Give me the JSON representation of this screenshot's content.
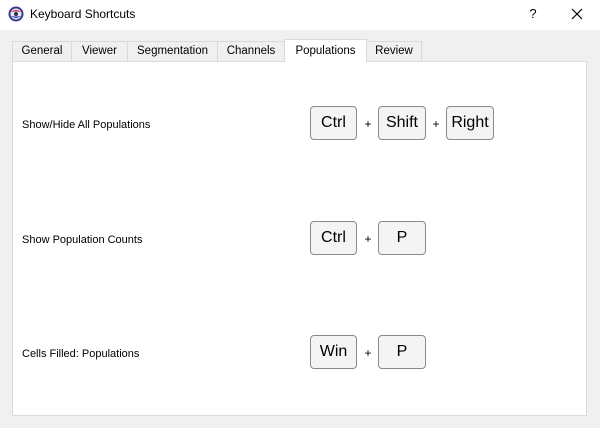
{
  "window": {
    "title": "Keyboard Shortcuts",
    "help_label": "?"
  },
  "tabs": [
    {
      "label": "General"
    },
    {
      "label": "Viewer"
    },
    {
      "label": "Segmentation"
    },
    {
      "label": "Channels"
    },
    {
      "label": "Populations",
      "active": true
    },
    {
      "label": "Review"
    }
  ],
  "shortcuts": [
    {
      "label": "Show/Hide All Populations",
      "keys": [
        "Ctrl",
        "Shift",
        "Right"
      ]
    },
    {
      "label": "Show Population Counts",
      "keys": [
        "Ctrl",
        "P"
      ]
    },
    {
      "label": "Cells Filled: Populations",
      "keys": [
        "Win",
        "P"
      ]
    }
  ],
  "separator": "+",
  "colors": {
    "title_bg": "#ffffff",
    "window_bg": "#f0f0f0",
    "panel_bg": "#ffffff",
    "key_border": "#8a8a8a",
    "key_bg": "#f4f4f4"
  }
}
